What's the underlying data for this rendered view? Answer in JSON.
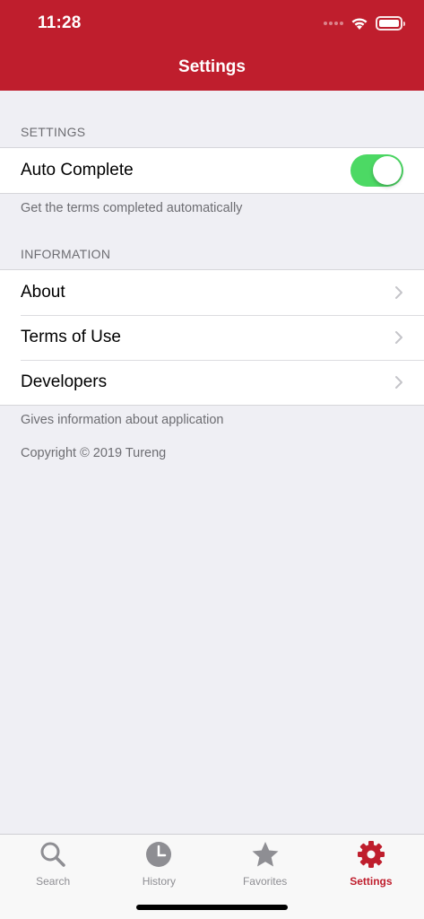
{
  "status_bar": {
    "time": "11:28"
  },
  "nav": {
    "title": "Settings"
  },
  "settings_section": {
    "header": "SETTINGS",
    "rows": [
      {
        "label": "Auto Complete",
        "toggle_on": true
      }
    ],
    "footer": "Get the terms completed automatically"
  },
  "information_section": {
    "header": "INFORMATION",
    "rows": [
      {
        "label": "About"
      },
      {
        "label": "Terms of Use"
      },
      {
        "label": "Developers"
      }
    ],
    "footer": "Gives information about application"
  },
  "copyright": "Copyright © 2019 Tureng",
  "tabbar": {
    "tabs": [
      {
        "label": "Search",
        "icon": "search-icon",
        "active": false
      },
      {
        "label": "History",
        "icon": "clock-icon",
        "active": false
      },
      {
        "label": "Favorites",
        "icon": "star-icon",
        "active": false
      },
      {
        "label": "Settings",
        "icon": "gear-icon",
        "active": true
      }
    ]
  },
  "colors": {
    "brand_red": "#bf1e2d",
    "toggle_green": "#4cd964",
    "background": "#efeff4",
    "inactive_gray": "#8e8e93"
  }
}
